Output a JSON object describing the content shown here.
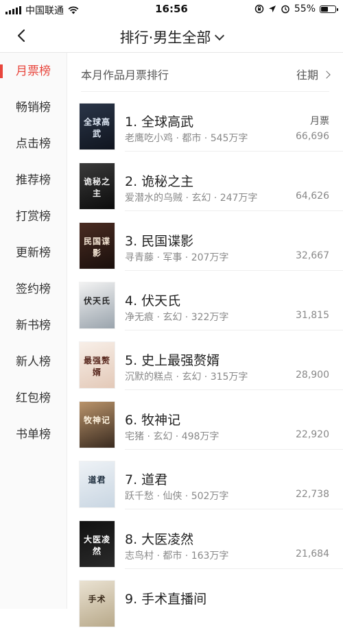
{
  "status_bar": {
    "carrier": "中国联通",
    "time": "16:56",
    "battery": "55%",
    "battery_level": 0.55
  },
  "nav": {
    "title": "排行·男生全部"
  },
  "sidebar": {
    "items": [
      {
        "label": "月票榜",
        "active": true
      },
      {
        "label": "畅销榜"
      },
      {
        "label": "点击榜"
      },
      {
        "label": "推荐榜"
      },
      {
        "label": "打赏榜"
      },
      {
        "label": "更新榜"
      },
      {
        "label": "签约榜"
      },
      {
        "label": "新书榜"
      },
      {
        "label": "新人榜"
      },
      {
        "label": "红包榜"
      },
      {
        "label": "书单榜"
      }
    ]
  },
  "main": {
    "header_title": "本月作品月票排行",
    "past_link": "往期",
    "count_label": "月票",
    "books": [
      {
        "title": "1. 全球高武",
        "meta": "老鹰吃小鸡 · 都市 · 545万字",
        "count": "66,696",
        "cover_text": "全球高武",
        "cover_colors": [
          "#2a3548",
          "#10151f"
        ],
        "cover_text_color": "#dfe8f5"
      },
      {
        "title": "2. 诡秘之主",
        "meta": "爱潜水的乌贼 · 玄幻 · 247万字",
        "count": "64,626",
        "cover_text": "诡秘之主",
        "cover_colors": [
          "#3a3a3a",
          "#0c0c0c"
        ],
        "cover_text_color": "#f0f0f0"
      },
      {
        "title": "3. 民国谍影",
        "meta": "寻青藤 · 军事 · 207万字",
        "count": "32,667",
        "cover_text": "民国谍影",
        "cover_colors": [
          "#4a2c22",
          "#1a0f0c"
        ],
        "cover_text_color": "#f5e6d5"
      },
      {
        "title": "4. 伏天氏",
        "meta": "净无痕 · 玄幻 · 322万字",
        "count": "31,815",
        "cover_text": "伏天氏",
        "cover_colors": [
          "#f2f2f2",
          "#9aa4ad"
        ],
        "cover_text_color": "#222222"
      },
      {
        "title": "5. 史上最强赘婿",
        "meta": "沉默的糕点 · 玄幻 · 315万字",
        "count": "28,900",
        "cover_text": "最强赘婿",
        "cover_colors": [
          "#f8efe8",
          "#e3c9b8"
        ],
        "cover_text_color": "#5a2a20"
      },
      {
        "title": "6. 牧神记",
        "meta": "宅猪 · 玄幻 · 498万字",
        "count": "22,920",
        "cover_text": "牧神记",
        "cover_colors": [
          "#b9936a",
          "#3a2b20"
        ],
        "cover_text_color": "#fff4e0"
      },
      {
        "title": "7. 道君",
        "meta": "跃千愁 · 仙侠 · 502万字",
        "count": "22,738",
        "cover_text": "道君",
        "cover_colors": [
          "#eef2f6",
          "#c9d6e2"
        ],
        "cover_text_color": "#1a2a3a"
      },
      {
        "title": "8. 大医凌然",
        "meta": "志鸟村 · 都市 · 163万字",
        "count": "21,684",
        "cover_text": "大医凌然",
        "cover_colors": [
          "#111111",
          "#2a2a2a"
        ],
        "cover_text_color": "#ffffff"
      },
      {
        "title": "9. 手术直播间",
        "meta": "",
        "count": "",
        "cover_text": "手术",
        "cover_colors": [
          "#eae2d2",
          "#b8a98a"
        ],
        "cover_text_color": "#3a2a1a"
      }
    ]
  },
  "colors": {
    "accent": "#e8453c",
    "text": "#222222",
    "meta": "#888888",
    "divider": "#eeeeee"
  }
}
